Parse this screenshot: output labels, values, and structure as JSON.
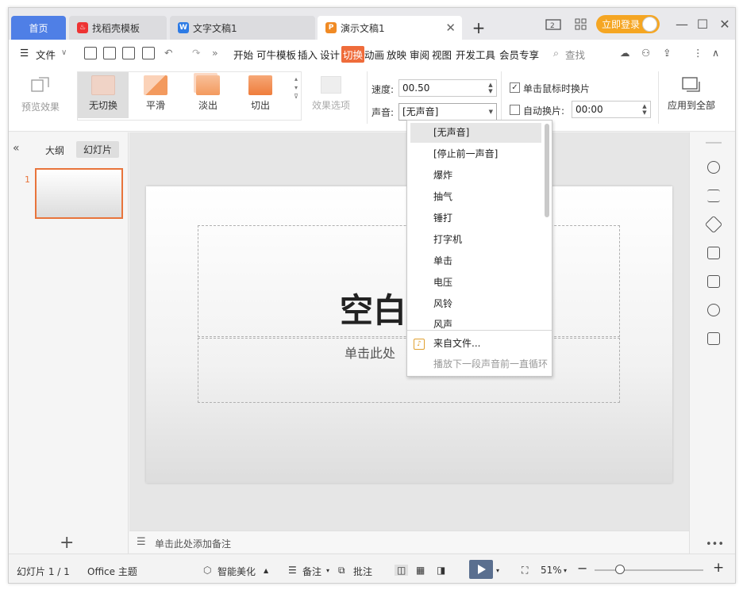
{
  "tabs": {
    "home": "首页",
    "t1": "找稻壳模板",
    "t2": "文字文稿1",
    "t3": "演示文稿1",
    "login": "立即登录"
  },
  "menu": {
    "file": "文件",
    "items": [
      "开始",
      "可牛模板",
      "插入",
      "设计",
      "切换",
      "动画",
      "放映",
      "审阅",
      "视图",
      "开发工具",
      "会员专享"
    ],
    "search": "查找"
  },
  "ribbon": {
    "preview": "预览效果",
    "transitions": [
      "无切换",
      "平滑",
      "淡出",
      "切出"
    ],
    "effect_options": "效果选项",
    "speed_label": "速度:",
    "speed_value": "00.50",
    "sound_label": "声音:",
    "sound_value": "[无声音]",
    "click_advance": "单击鼠标时换片",
    "auto_advance": "自动换片:",
    "auto_time": "00:00",
    "apply_all": "应用到全部"
  },
  "left": {
    "outline_tab": "大纲",
    "slides_tab": "幻灯片",
    "slide_num": "1"
  },
  "slide": {
    "title_part": "空白",
    "subtitle_part": "单击此处"
  },
  "notes_placeholder": "单击此处添加备注",
  "dropdown": {
    "items": [
      "[无声音]",
      "[停止前一声音]",
      "爆炸",
      "抽气",
      "锤打",
      "打字机",
      "单击",
      "电压",
      "风铃",
      "风声"
    ],
    "from_file": "来自文件...",
    "loop": "播放下一段声音前一直循环"
  },
  "status": {
    "slide_info": "幻灯片 1 / 1",
    "theme": "Office 主题",
    "beautify": "智能美化",
    "notes": "备注",
    "comments": "批注",
    "zoom": "51%"
  },
  "colors": {
    "accent": "#ef6c3b",
    "tab_home": "#4f7fe6",
    "login": "#f5a623"
  }
}
